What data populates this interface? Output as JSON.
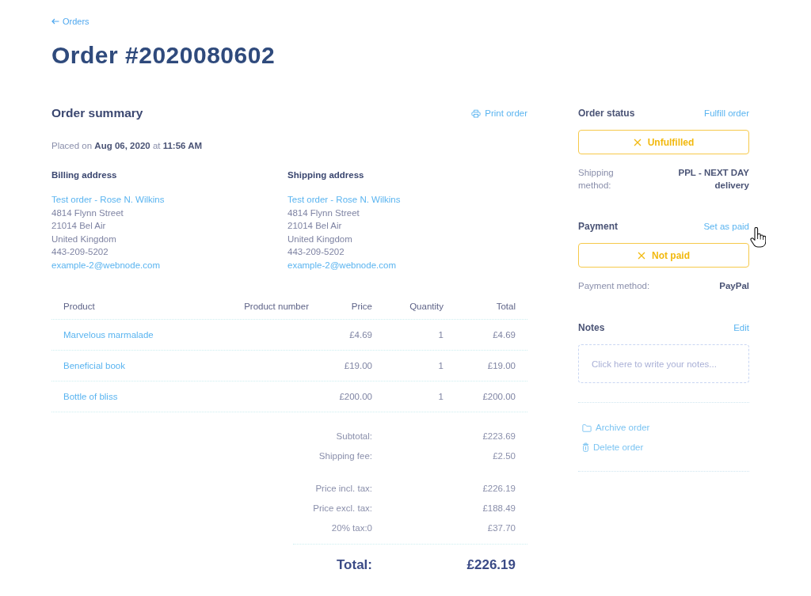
{
  "back_link": {
    "label": "Orders"
  },
  "title": "Order #2020080602",
  "order_summary": {
    "heading": "Order summary",
    "print_link": "Print order",
    "placed_on": "Placed on **Aug 06, 2020** at **11:56 AM**",
    "addresses": [
      {
        "heading": "Billing address",
        "name": "Test order - Rose N. Wilkins",
        "lines": [
          "4814 Flynn Street",
          "21014 Bel Air",
          "United Kingdom",
          "443-209-5202"
        ],
        "email": "example-2@webnode.com"
      },
      {
        "heading": "Shipping address",
        "name": "Test order - Rose N. Wilkins",
        "lines": [
          "4814 Flynn Street",
          "21014 Bel Air",
          "United Kingdom",
          "443-209-5202"
        ],
        "email": "example-2@webnode.com"
      }
    ],
    "table": {
      "columns": [
        "Product",
        "Product number",
        "Price",
        "Quantity",
        "Total"
      ],
      "rows": [
        {
          "product": "Marvelous marmalade",
          "price": "£4.69",
          "quantity": "1",
          "total": "£4.69"
        },
        {
          "product": "Beneficial book",
          "price": "£19.00",
          "quantity": "1",
          "total": "£19.00"
        },
        {
          "product": "Bottle of bliss",
          "price": "£200.00",
          "quantity": "1",
          "total": "£200.00"
        }
      ]
    },
    "totals": {
      "groups": [
        {
          "items": [
            {
              "label": "Subtotal:",
              "value": "£223.69"
            },
            {
              "label": "Shipping fee:",
              "value": "£2.50"
            }
          ]
        },
        {
          "items": [
            {
              "label": "Price incl. tax:",
              "value": "£226.19"
            },
            {
              "label": "Price excl. tax:",
              "value": "£188.49"
            },
            {
              "label": "20% tax:0",
              "value": "£37.70"
            }
          ]
        }
      ],
      "grand_total": {
        "label": "Total:",
        "value": "£226.19"
      }
    }
  },
  "sidebar": {
    "panels": [
      {
        "heading": "Order status",
        "action": "Fulfill order",
        "badge": {
          "label": "Unfulfilled",
          "done": false
        },
        "details": [
          {
            "label": "Shipping method:",
            "value": "PPL - NEXT DAY delivery"
          }
        ]
      },
      {
        "heading": "Payment",
        "action": "Set as paid",
        "badge": {
          "label": "Not paid",
          "done": false
        },
        "details": [
          {
            "label": "Payment method:",
            "value": "PayPal"
          }
        ]
      }
    ],
    "notes": {
      "heading": "Notes",
      "action": "Edit",
      "placeholder": "Click here to write your notes..."
    },
    "actions": [
      {
        "kind": "archive",
        "label": "Archive order"
      },
      {
        "kind": "delete",
        "label": "Delete order"
      }
    ]
  }
}
